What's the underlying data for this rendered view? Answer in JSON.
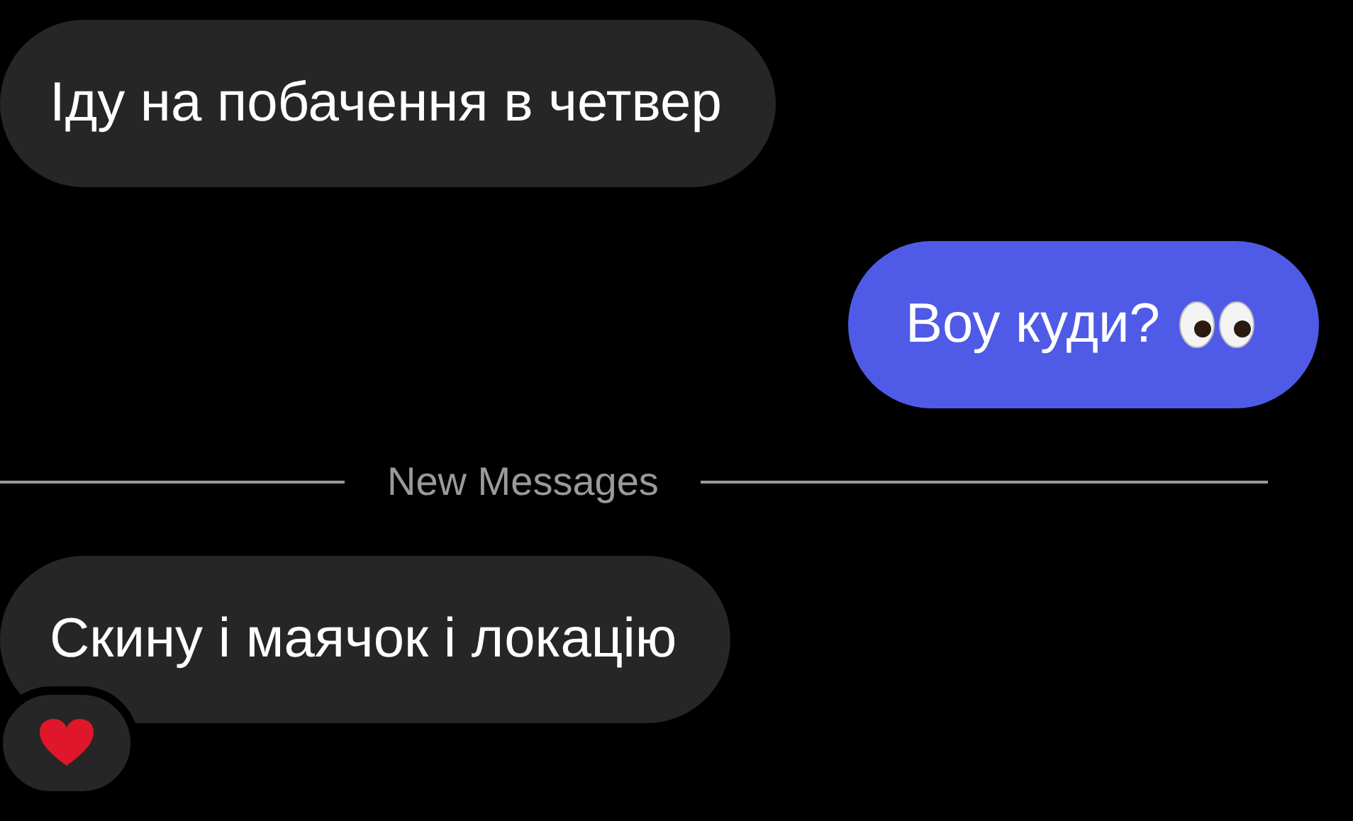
{
  "messages": [
    {
      "kind": "received",
      "text": "Іду на побачення в четвер",
      "eyes": false,
      "reaction": false
    },
    {
      "kind": "sent",
      "text": "Воу куди?",
      "eyes": true,
      "reaction": false
    },
    {
      "kind": "divider",
      "text": "New Messages"
    },
    {
      "kind": "received",
      "text": "Скину і маячок і локацію",
      "eyes": false,
      "reaction": true
    }
  ]
}
